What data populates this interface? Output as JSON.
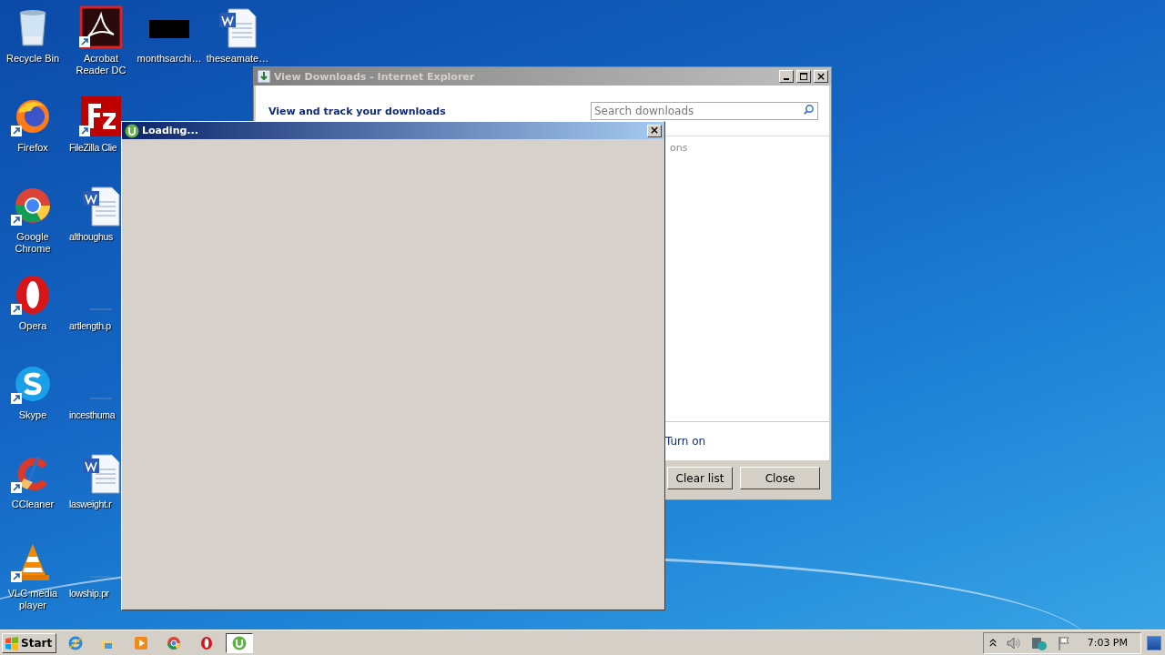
{
  "desktop_columns": [
    {
      "icons": [
        {
          "label": "Recycle Bin",
          "kind": "recycle"
        },
        {
          "label": "Firefox",
          "kind": "firefox"
        },
        {
          "label": "Google Chrome",
          "kind": "chrome"
        },
        {
          "label": "Opera",
          "kind": "opera"
        },
        {
          "label": "Skype",
          "kind": "skype"
        },
        {
          "label": "CCleaner",
          "kind": "ccleaner"
        },
        {
          "label": "VLC media player",
          "kind": "vlc"
        }
      ]
    },
    {
      "icons": [
        {
          "label": "Acrobat Reader DC",
          "kind": "acrobat"
        },
        {
          "label": "FileZilla Clie",
          "kind": "filezilla"
        },
        {
          "label": "althoughus",
          "kind": "word"
        },
        {
          "label": "artlength.p",
          "kind": "blank"
        },
        {
          "label": "incesthuma",
          "kind": "blank"
        },
        {
          "label": "lasweight.r",
          "kind": "word"
        },
        {
          "label": "lowship.pr",
          "kind": "blank"
        }
      ]
    },
    {
      "icons": [
        {
          "label": "monthsarchi…",
          "kind": "black"
        }
      ]
    },
    {
      "icons": [
        {
          "label": "theseamate…",
          "kind": "word"
        }
      ]
    }
  ],
  "downloads_window": {
    "title": "View Downloads - Internet Explorer",
    "heading": "View and track your downloads",
    "search": {
      "placeholder": "Search downloads"
    },
    "partial_text": "ons",
    "link": "Turn on",
    "buttons": [
      "Clear list",
      "Close"
    ]
  },
  "loading_window": {
    "title": "Loading..."
  },
  "taskbar": {
    "start": "Start",
    "apps": [
      {
        "kind": "ie",
        "selected": false
      },
      {
        "kind": "folder",
        "selected": false
      },
      {
        "kind": "media",
        "selected": false
      },
      {
        "kind": "chrome",
        "selected": false
      },
      {
        "kind": "opera",
        "selected": false
      },
      {
        "kind": "utorrent",
        "selected": true
      }
    ],
    "clock": "7:03 PM"
  }
}
